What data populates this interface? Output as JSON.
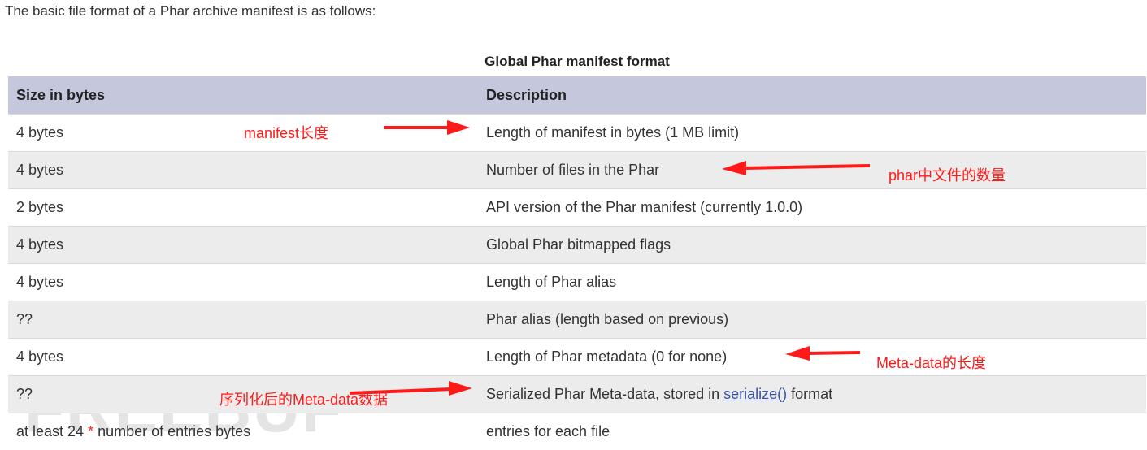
{
  "intro_text": "The basic file format of a Phar archive manifest is as follows:",
  "table": {
    "caption": "Global Phar manifest format",
    "headers": [
      "Size in bytes",
      "Description"
    ],
    "rows": [
      {
        "size": "4 bytes",
        "desc": "Length of manifest in bytes (1 MB limit)"
      },
      {
        "size": "4 bytes",
        "desc": "Number of files in the Phar"
      },
      {
        "size": "2 bytes",
        "desc": "API version of the Phar manifest (currently 1.0.0)"
      },
      {
        "size": "4 bytes",
        "desc": "Global Phar bitmapped flags"
      },
      {
        "size": "4 bytes",
        "desc": "Length of Phar alias"
      },
      {
        "size": "??",
        "desc": "Phar alias (length based on previous)"
      },
      {
        "size": "4 bytes",
        "desc": "Length of Phar metadata (0 for none)"
      },
      {
        "size": "??",
        "desc_pre": "Serialized Phar Meta-data, stored in ",
        "desc_link": "serialize()",
        "desc_post": " format"
      },
      {
        "size_pre": "at least 24 ",
        "size_mid": "*",
        "size_post": " number of entries bytes",
        "desc": "entries for each file"
      }
    ]
  },
  "annotations": {
    "manifest_length": "manifest长度",
    "file_count": "phar中文件的数量",
    "metadata_length": "Meta-data的长度",
    "serialized_metadata": "序列化后的Meta-data数据"
  },
  "watermark": "FREEBUF",
  "colors": {
    "header_bg": "#c5c8dc",
    "stripe_bg": "#ececec",
    "annotation": "#ff1a1a",
    "link": "#3b54a8"
  }
}
